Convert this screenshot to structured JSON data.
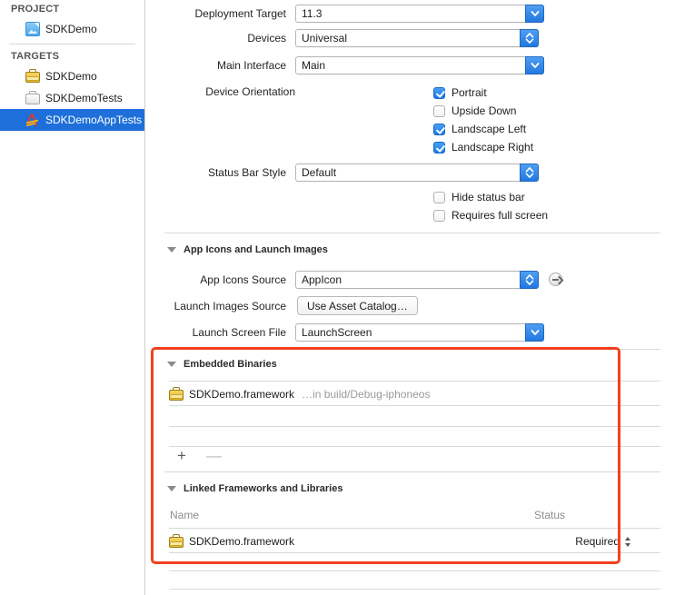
{
  "sidebar": {
    "project_header": "PROJECT",
    "targets_header": "TARGETS",
    "project_items": [
      {
        "label": "SDKDemo",
        "icon": "project-blueprint-icon"
      }
    ],
    "target_items": [
      {
        "label": "SDKDemo",
        "icon": "toolbox-yellow-icon",
        "selected": false
      },
      {
        "label": "SDKDemoTests",
        "icon": "toolbox-gray-icon",
        "selected": false
      },
      {
        "label": "SDKDemoAppTests",
        "icon": "xcode-a-icon",
        "selected": true
      }
    ]
  },
  "deployment_info": {
    "deployment_target": {
      "label": "Deployment Target",
      "value": "11.3",
      "control": "popup-chevron"
    },
    "devices": {
      "label": "Devices",
      "value": "Universal",
      "control": "popup-stepper"
    },
    "main_interface": {
      "label": "Main Interface",
      "value": "Main",
      "control": "popup-chevron"
    },
    "device_orientation": {
      "label": "Device Orientation",
      "options": [
        {
          "label": "Portrait",
          "checked": true
        },
        {
          "label": "Upside Down",
          "checked": false
        },
        {
          "label": "Landscape Left",
          "checked": true
        },
        {
          "label": "Landscape Right",
          "checked": true
        }
      ]
    },
    "status_bar_style": {
      "label": "Status Bar Style",
      "value": "Default",
      "control": "popup-stepper"
    },
    "extra_options": [
      {
        "label": "Hide status bar",
        "checked": false
      },
      {
        "label": "Requires full screen",
        "checked": false
      }
    ]
  },
  "app_icons_section": {
    "title": "App Icons and Launch Images",
    "app_icons_source": {
      "label": "App Icons Source",
      "value": "AppIcon",
      "control": "popup-stepper"
    },
    "launch_images_source": {
      "label": "Launch Images Source",
      "button_label": "Use Asset Catalog…"
    },
    "launch_screen_file": {
      "label": "Launch Screen File",
      "value": "LaunchScreen",
      "control": "popup-chevron"
    }
  },
  "embedded_binaries": {
    "title": "Embedded Binaries",
    "items": [
      {
        "name": "SDKDemo.framework",
        "path": "…in build/Debug-iphoneos",
        "icon": "framework-toolbox-icon"
      }
    ],
    "add_label": "+",
    "remove_label": "—"
  },
  "linked_frameworks": {
    "title": "Linked Frameworks and Libraries",
    "columns": {
      "name": "Name",
      "status": "Status"
    },
    "items": [
      {
        "name": "SDKDemo.framework",
        "status": "Required",
        "icon": "framework-toolbox-icon"
      }
    ]
  },
  "annotation": {
    "highlight_color": "#f4401f"
  }
}
